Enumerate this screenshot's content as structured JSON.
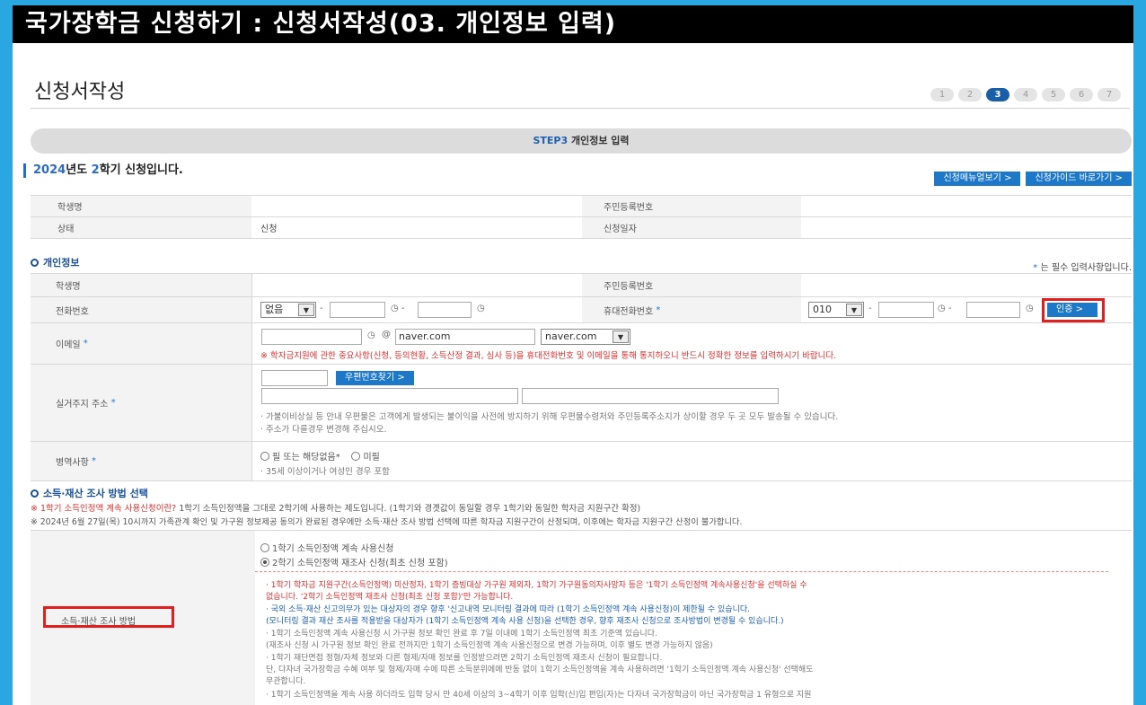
{
  "header": {
    "title": "국가장학금 신청하기 : 신청서작성(03. 개인정보 입력)"
  },
  "page": {
    "title": "신청서작성"
  },
  "steps": [
    "1",
    "2",
    "3",
    "4",
    "5",
    "6",
    "7"
  ],
  "active_step": 3,
  "banner": {
    "step": "STEP3",
    "label": "개인정보 입력"
  },
  "semester": {
    "year": "2024",
    "mid": "년도 ",
    "term": "2",
    "suffix": "학기 신청입니다."
  },
  "buttons": {
    "menu_guide": "신청메뉴얼보기 >",
    "apply_guide": "신청가이드 바로가기 >"
  },
  "summary": {
    "name_label": "학생명",
    "rrn_label": "주민등록번호",
    "status_label": "상태",
    "status_value": "신청",
    "date_label": "신청일자"
  },
  "personal": {
    "section_title": "개인정보",
    "required_note": " 는 필수 입력사항입니다.",
    "star": "*",
    "name_label": "학생명",
    "rrn_label": "주민등록번호",
    "phone_label": "전화번호",
    "phone_prefix": "없음",
    "mobile_label": "휴대전화번호",
    "mobile_prefix": "010",
    "verify_button": "인증 >",
    "email_label": "이메일",
    "email_at": "@",
    "email_domain": "naver.com",
    "email_select": "naver.com",
    "email_notice": "※ 학자금지원에 관한 중요사항(신청, 등의현황, 소득산정 결과, 심사 등)을 휴대전화번호 및 이메일을 통해 통지하오니 반드시 정확한 정보를 입력하시기 바랍니다.",
    "address_label": "실거주지 주소",
    "zip_button": "우편번호찾기 >",
    "address_note1": "· 가불이비상실 등 안내 우편물은 고객에게 발생되는 불이익을 사전에 방지하기 위해 우편물수령처와 주민등록주소지가 상이할 경우 두 곳 모두 발송될 수 있습니다.",
    "address_note2": "· 주소가 다를경우 변경해 주십시오.",
    "military_label": "병역사항",
    "military_opt1": "필 또는 해당없음*",
    "military_opt2": "미필",
    "military_note": "· 35세 이상이거나 여성인 경우 포함"
  },
  "income": {
    "section_title": "소득·재산 조사 방법 선택",
    "notice1_red": "※ 1학기 소득인정액 계속 사용신청이란?",
    "notice1_rest": " 1학기 소득인정액을 그대로 2학기에 사용하는 제도입니다. (1학기와 경곗값이 동일할 경우 1학기와 동일한 학자금 지원구간 확정)",
    "notice2": "※ 2024년 6월 27일(목) 10시까지 가족관계 확인 및 가구원 정보제공 동의가 완료된 경우에만 소득·재산 조사 방법 선택에 따른 학자금 지원구간이 산정되며, 이후에는 학자금 지원구간 산정이 불가합니다.",
    "method_label": "소득·재산 조사 방법",
    "option1": "1학기 소득인정액 계속 사용신청",
    "option2": "2학기 소득인정액 재조사 신청(최초 신청 포함)",
    "red1": "· 1학기 학자금 지원구간(소득인정액) 미산정자, 1학기 증빙대상 가구원 제외자, 1학기 가구원동의자사망자 등은 '1학기 소득인정액 계속사용신청'을 선택하실 수",
    "red2": "없습니다. '2학기 소득인정액 재조사 신청(최초 신청 포함)'만 가능합니다.",
    "blue1": "· 국외 소득·재산 신고의무가 있는 대상자의 경우 향후 '신고내역 모니터링 결과에 따라 (1학기 소득인정액 계속 사용신청)이 제한될 수 있습니다.",
    "blue2": "(모니터링 결과 재산 조사를 적용받을 대상자가 (1학기 소득인정액 계속 사용 신청)을 선택한 경우, 향후 재조사 신청으로 조사방법이 변경될 수 있습니다.)",
    "gray1": "· 1학기 소득인정액 계속 사용신청 시 가구원 정보 확인 완료 후 7일 이내에 1학기 소득인정액 최초 기준액 있습니다.",
    "gray2": "(재조사 신청 시 가구원 정보 확인 완료 전까지만 1학기 소득인정액 계속 사용신청으로 변경 가능하며, 이후 별도 변경 가능하지 않음)",
    "gray3": "· 1학기 재단면접 정형/자체 정보와 다른 형제/자매 정보를 인정받으려면 2학기 소득인정액 재조사 신청이 필요합니다.",
    "gray4": "단, 다자녀 국가장학금 수혜 여부 및 형제/자매 수에 따른 소득분위에에 반동 없이 1학기 소득인정액을 계속 사용하려면 '1학기 소득인정액 계속 사용신청' 선택해도",
    "gray5": "무관합니다.",
    "gray6": "· 1학기 소득인정액을 계속 사용 하더라도 입학 당시 만 40세 이상의 3~4학기 이후 입학(신)입 편입(자)는 다자녀 국가장학금이 아닌 국가장학금 1 유형으로 지원"
  },
  "colors": {
    "accent": "#1e78c8",
    "highlight": "#e02020",
    "frame": "#2aa7e0"
  }
}
